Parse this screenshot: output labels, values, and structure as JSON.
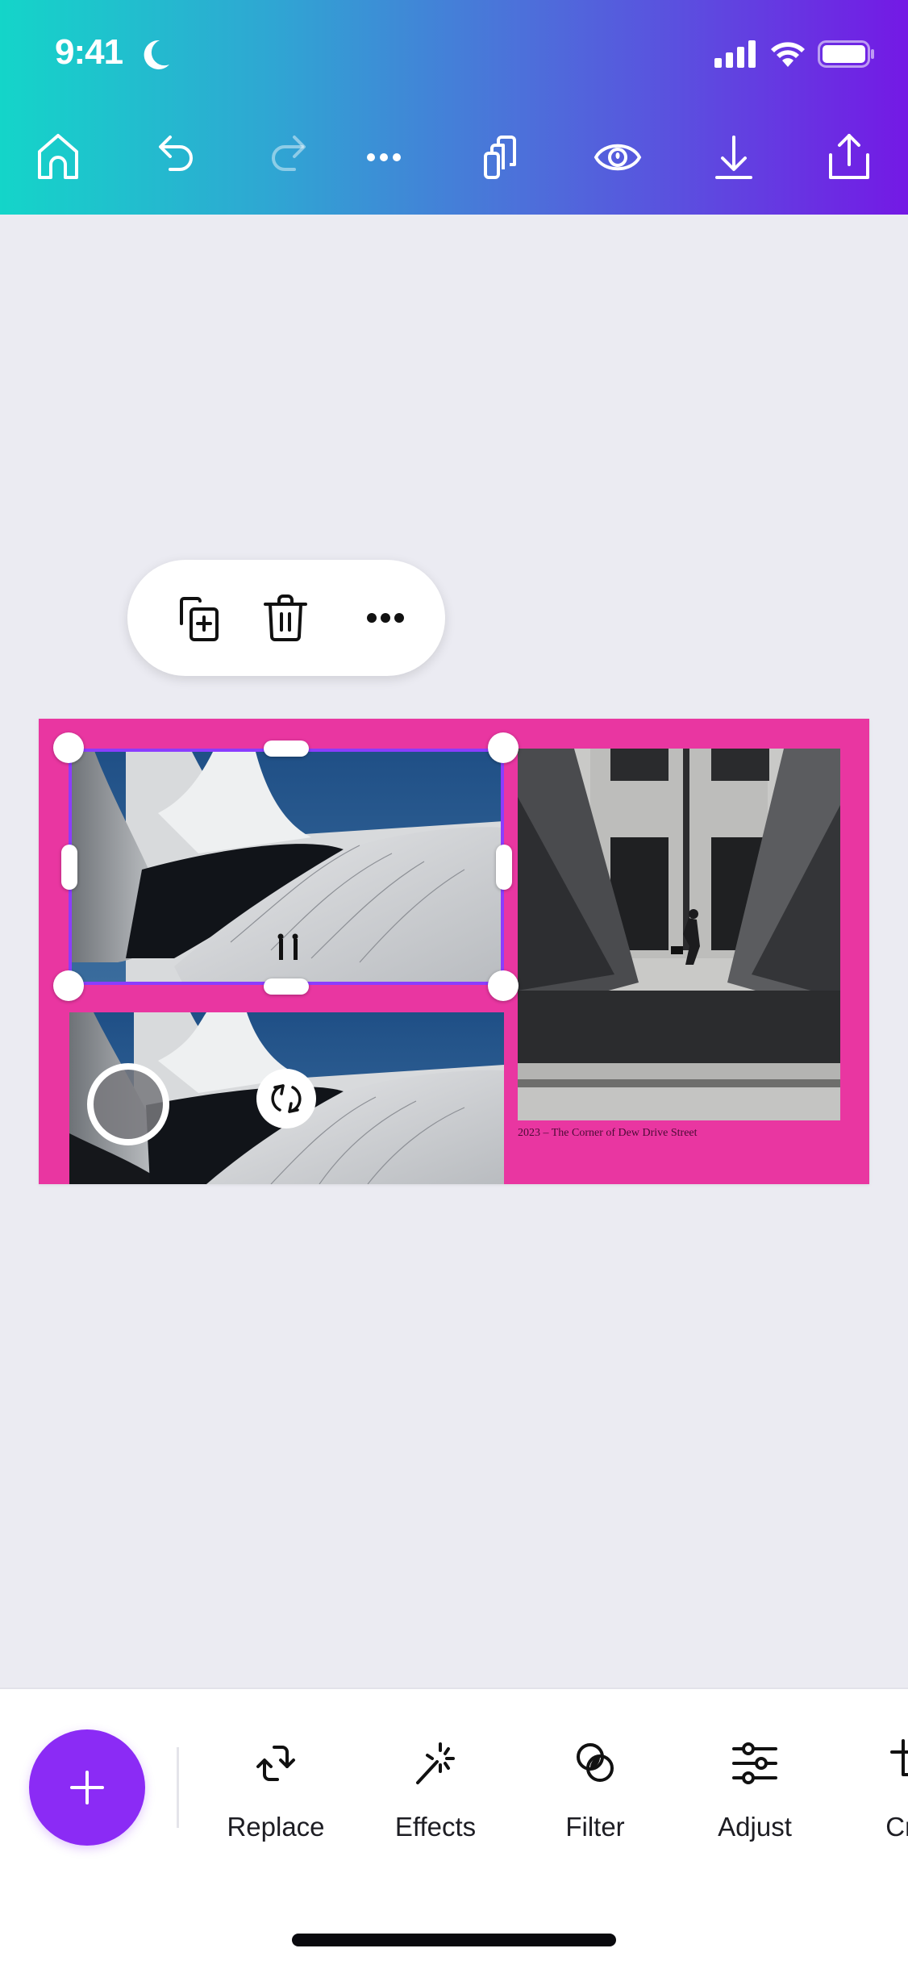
{
  "status_bar": {
    "time": "9:41",
    "focus_icon": "moon-icon",
    "signal_icon": "cellular-signal-icon",
    "wifi_icon": "wifi-icon",
    "battery_icon": "battery-icon"
  },
  "header": {
    "gradient_start": "#14d5c9",
    "gradient_end": "#7419e5",
    "toolbar": [
      {
        "name": "home",
        "icon": "home-icon",
        "enabled": true
      },
      {
        "name": "undo",
        "icon": "undo-icon",
        "enabled": true
      },
      {
        "name": "redo",
        "icon": "redo-icon",
        "enabled": false
      },
      {
        "name": "more",
        "icon": "more-horizontal-icon",
        "enabled": true
      },
      {
        "name": "pages",
        "icon": "pages-icon",
        "enabled": true
      },
      {
        "name": "preview",
        "icon": "eye-icon",
        "enabled": true
      },
      {
        "name": "download",
        "icon": "download-icon",
        "enabled": true
      },
      {
        "name": "share",
        "icon": "share-icon",
        "enabled": true
      }
    ]
  },
  "context_menu": {
    "items": [
      {
        "name": "duplicate",
        "icon": "duplicate-icon"
      },
      {
        "name": "delete",
        "icon": "trash-icon"
      },
      {
        "name": "more",
        "icon": "more-horizontal-icon"
      }
    ]
  },
  "design": {
    "background_color": "#e936a1",
    "selection_color": "#8b3dff",
    "photos": [
      {
        "name": "curved-white-architecture-top",
        "selected": true
      },
      {
        "name": "curved-white-architecture-bottom",
        "selected": false
      },
      {
        "name": "man-walking-between-sculptures",
        "selected": false
      }
    ],
    "caption": "2023 – The Corner of Dew Drive Street"
  },
  "bottom_bar": {
    "add_button_color": "#8b2bf5",
    "tools": [
      {
        "label": "Replace",
        "icon": "replace-icon"
      },
      {
        "label": "Effects",
        "icon": "magic-wand-icon"
      },
      {
        "label": "Filter",
        "icon": "filter-icon"
      },
      {
        "label": "Adjust",
        "icon": "sliders-icon"
      },
      {
        "label": "Crop",
        "icon": "crop-icon"
      }
    ]
  }
}
